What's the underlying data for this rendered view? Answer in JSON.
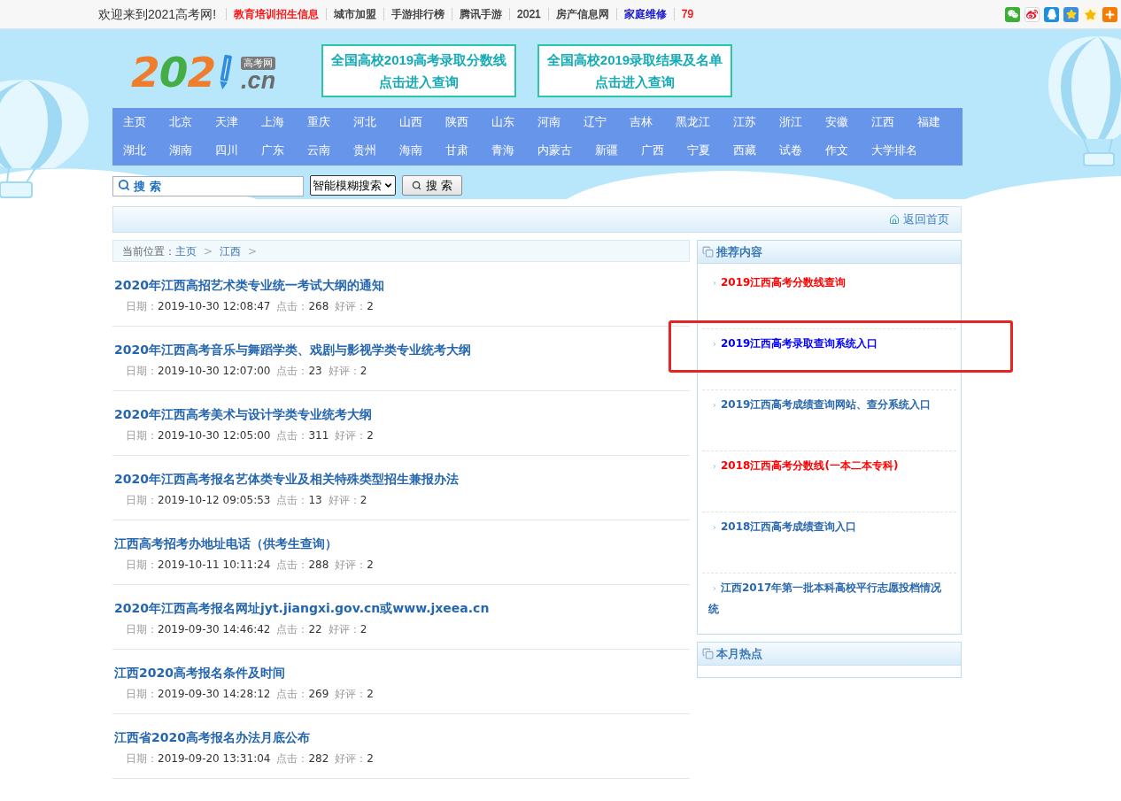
{
  "top_bar": {
    "welcome": "欢迎来到2021高考网!",
    "links": [
      {
        "label": "教育培训招生信息",
        "color": "#ff0000"
      },
      {
        "label": "城市加盟",
        "color": "#333333"
      },
      {
        "label": "手游排行榜",
        "color": "#333333"
      },
      {
        "label": "腾讯手游",
        "color": "#333333"
      },
      {
        "label": "2021",
        "color": "#333333"
      },
      {
        "label": "房产信息网",
        "color": "#333333"
      },
      {
        "label": "家庭维修",
        "color": "#0000cc"
      },
      {
        "label": "79",
        "color": "#ff0000"
      }
    ]
  },
  "header": {
    "logo": {
      "wordmark": "202",
      "badge": "高考网",
      "domain": ".cn"
    },
    "banners": [
      {
        "line_1": "全国高校2019高考录取分数线",
        "line_2": "点击进入查询"
      },
      {
        "line_1": "全国高校2019录取结果及名单",
        "line_2": "点击进入查询"
      }
    ]
  },
  "nav": {
    "rows": [
      [
        "主页",
        "北京",
        "天津",
        "上海",
        "重庆",
        "河北",
        "山西",
        "陕西",
        "山东",
        "河南",
        "辽宁",
        "吉林",
        "黑龙江",
        "江苏",
        "浙江",
        "安徽",
        "江西",
        "福建"
      ],
      [
        "湖北",
        "湖南",
        "四川",
        "广东",
        "云南",
        "贵州",
        "海南",
        "甘肃",
        "青海",
        "内蒙古",
        "新疆",
        "广西",
        "宁夏",
        "西藏",
        "试卷",
        "作文",
        "大学排名"
      ]
    ]
  },
  "search": {
    "placeholder": "搜 索",
    "mode": "智能模糊搜索",
    "button": "搜 索"
  },
  "home_bar": {
    "link": "返回首页"
  },
  "breadcrumb": [
    {
      "kind": "label",
      "text": "当前位置："
    },
    {
      "kind": "link",
      "text": "主页"
    },
    {
      "kind": "separator",
      "text": ">"
    },
    {
      "kind": "link",
      "text": "江西"
    },
    {
      "kind": "separator",
      "text": ">"
    }
  ],
  "articles": [
    {
      "title": "2020年江西高招艺术类专业统一考试大纲的通知",
      "date_label": "日期：",
      "date": "2019-10-30 12:08:47",
      "clicks_label": "点击：",
      "clicks": "268",
      "rating_label": "好评：",
      "rating": "2"
    },
    {
      "title": "2020年江西高考音乐与舞蹈学类、戏剧与影视学类专业统考大纲",
      "date_label": "日期：",
      "date": "2019-10-30 12:07:00",
      "clicks_label": "点击：",
      "clicks": "23",
      "rating_label": "好评：",
      "rating": "2"
    },
    {
      "title": "2020年江西高考美术与设计学类专业统考大纲",
      "date_label": "日期：",
      "date": "2019-10-30 12:05:00",
      "clicks_label": "点击：",
      "clicks": "311",
      "rating_label": "好评：",
      "rating": "2"
    },
    {
      "title": "2020年江西高考报名艺体类专业及相关特殊类型招生兼报办法",
      "date_label": "日期：",
      "date": "2019-10-12 09:05:53",
      "clicks_label": "点击：",
      "clicks": "13",
      "rating_label": "好评：",
      "rating": "2"
    },
    {
      "title": "江西高考招考办地址电话（供考生查询）",
      "date_label": "日期：",
      "date": "2019-10-11 10:11:24",
      "clicks_label": "点击：",
      "clicks": "288",
      "rating_label": "好评：",
      "rating": "2"
    },
    {
      "title": "2020年江西高考报名网址jyt.jiangxi.gov.cn或www.jxeea.cn",
      "date_label": "日期：",
      "date": "2019-09-30 14:46:42",
      "clicks_label": "点击：",
      "clicks": "22",
      "rating_label": "好评：",
      "rating": "2"
    },
    {
      "title": "江西2020高考报名条件及时间",
      "date_label": "日期：",
      "date": "2019-09-30 14:28:12",
      "clicks_label": "点击：",
      "clicks": "269",
      "rating_label": "好评：",
      "rating": "2"
    },
    {
      "title": "江西省2020高考报名办法月底公布",
      "date_label": "日期：",
      "date": "2019-09-20 13:31:04",
      "clicks_label": "点击：",
      "clicks": "282",
      "rating_label": "好评：",
      "rating": "2"
    }
  ],
  "sidebar": {
    "panels": [
      {
        "title": "推荐内容",
        "items": [
          {
            "text": "2019江西高考分数线查询",
            "color": "#ff0000"
          },
          {
            "text": "2019江西高考录取查询系统入口",
            "color": "#0000ff"
          },
          {
            "text": "2019江西高考成绩查询网站、查分系统入口",
            "color": "#2a68ad"
          },
          {
            "text": "2018江西高考分数线(一本二本专科)",
            "color": "#ff0000"
          },
          {
            "text": "2018江西高考成绩查询入口",
            "color": "#2a68ad"
          },
          {
            "text": "江西2017年第一批本科高校平行志愿投档情况统",
            "color": "#2a68ad"
          }
        ]
      },
      {
        "title": "本月热点"
      }
    ]
  }
}
